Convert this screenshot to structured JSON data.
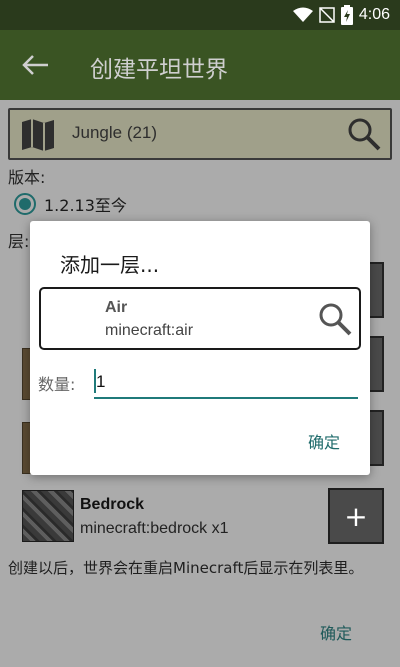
{
  "status": {
    "time": "4:06"
  },
  "appbar": {
    "title": "创建平坦世界"
  },
  "biome": {
    "label": "Jungle (21)"
  },
  "version": {
    "label": "版本:",
    "option": "1.2.13至今"
  },
  "layers": {
    "label": "层:",
    "bedrock": {
      "name": "Bedrock",
      "id": "minecraft:bedrock x1",
      "add_label": "+"
    }
  },
  "hint": "创建以后，世界会在重启Minecraft后显示在列表里。",
  "outer_confirm": "确定",
  "dialog": {
    "title": "添加一层...",
    "block_name": "Air",
    "block_id": "minecraft:air",
    "qty_label": "数量:",
    "qty_value": "1",
    "ok_label": "确定"
  }
}
